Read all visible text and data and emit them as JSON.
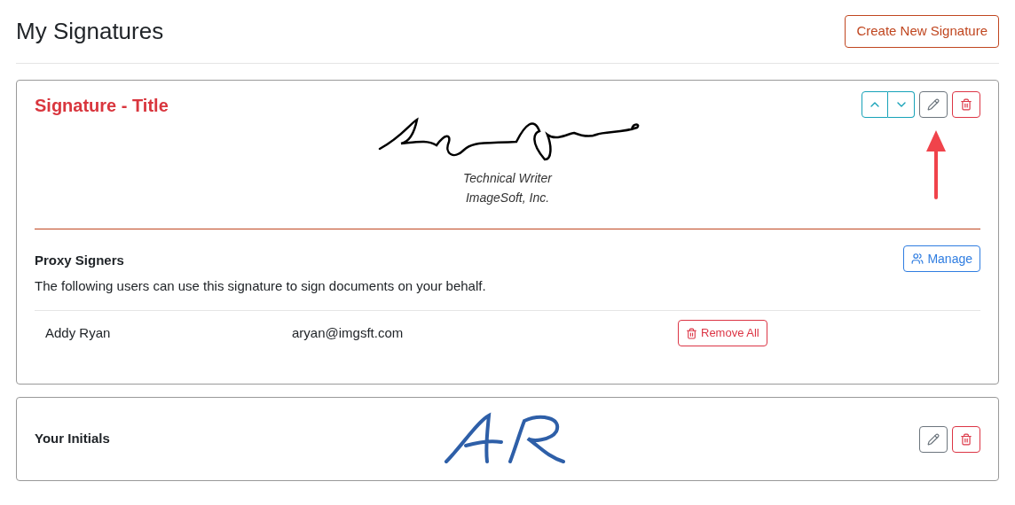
{
  "page_title": "My Signatures",
  "create_button": "Create New Signature",
  "signature_card": {
    "title": "Signature - Title",
    "lines": [
      "Technical Writer",
      "ImageSoft, Inc."
    ],
    "proxy": {
      "heading": "Proxy Signers",
      "manage_button": "Manage",
      "description": "The following users can use this signature to sign documents on your behalf.",
      "rows": [
        {
          "name": "Addy Ryan",
          "email": "aryan@imgsft.com",
          "action": "Remove All"
        }
      ]
    }
  },
  "initials_card": {
    "label": "Your Initials"
  }
}
